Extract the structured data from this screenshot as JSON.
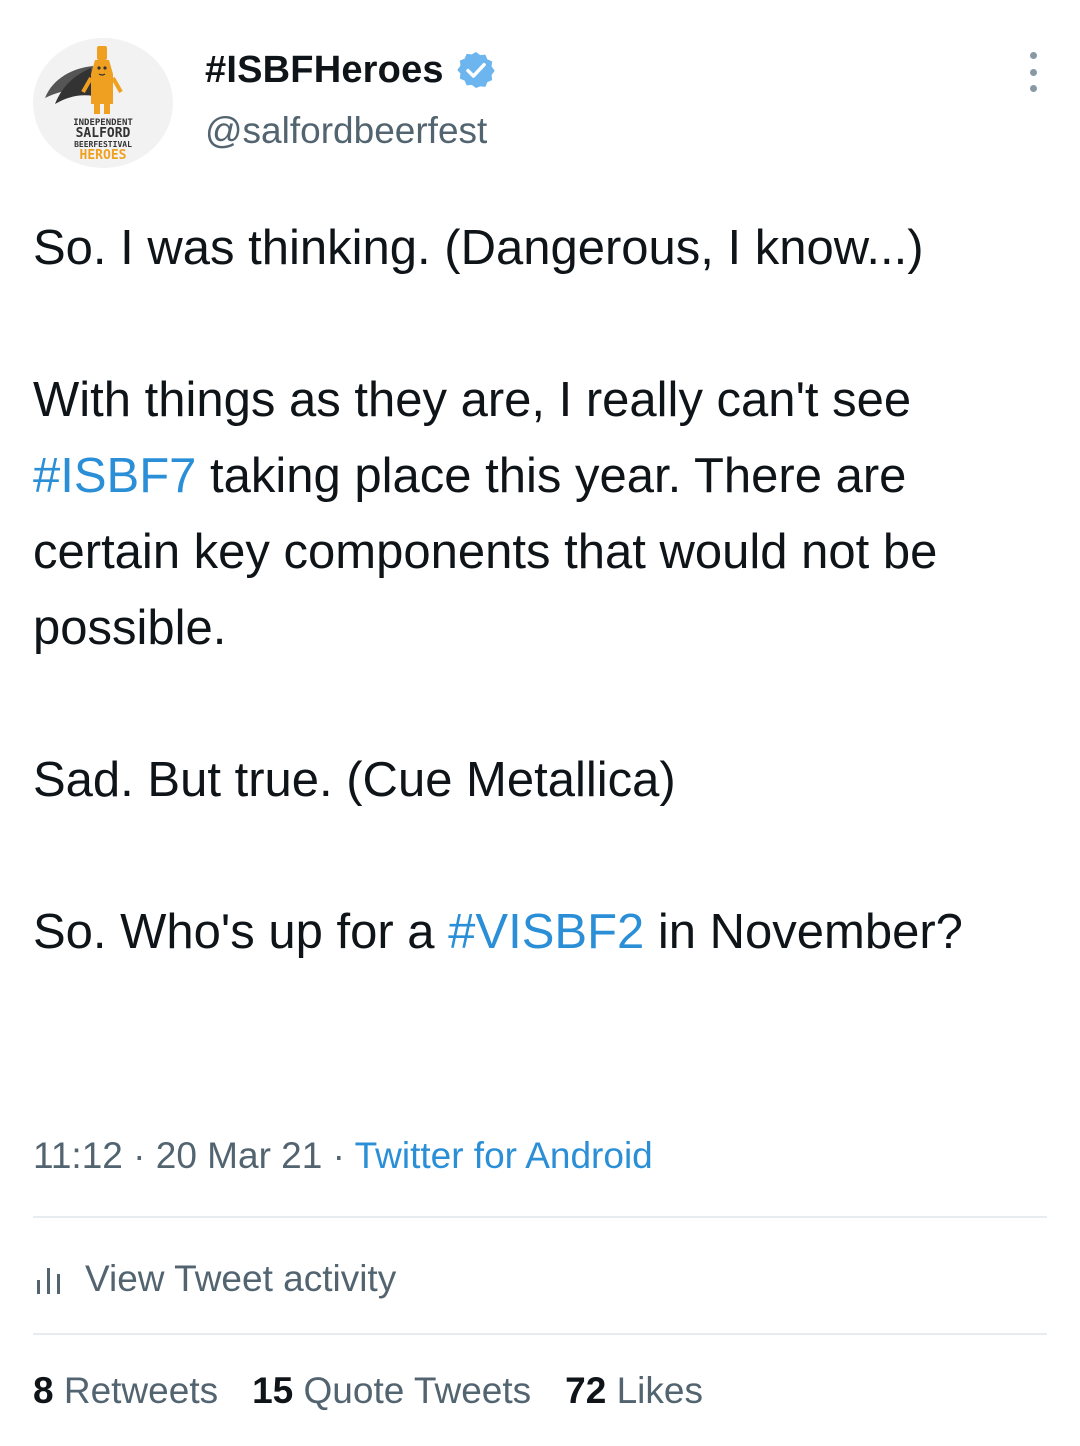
{
  "header": {
    "display_name": "#ISBFHeroes",
    "handle": "@salfordbeerfest",
    "avatar_logo_text": "INDEPENDENT SALFORD BEERFESTIVAL HEROES"
  },
  "tweet": {
    "p1": "So. I was thinking. (Dangerous, I know...)",
    "p2_a": "With things as they are, I really can't see ",
    "p2_hashtag": "#ISBF7",
    "p2_b": " taking place this year. There are certain key components that would not be possible.",
    "p3": "Sad. But true. (Cue Metallica)",
    "p4_a": "So. Who's up for a ",
    "p4_hashtag": "#VISBF2",
    "p4_b": " in November?"
  },
  "meta": {
    "time": "11:12",
    "sep1": " · ",
    "date": "20 Mar 21",
    "sep2": " · ",
    "source": "Twitter for Android"
  },
  "activity": {
    "label": "View Tweet activity"
  },
  "stats": {
    "retweets_count": "8",
    "retweets_label": "Retweets",
    "quotes_count": "15",
    "quotes_label": "Quote Tweets",
    "likes_count": "72",
    "likes_label": "Likes"
  },
  "colors": {
    "link": "#2a8fd6",
    "verified": "#6cb5ef",
    "secondary_text": "#536471",
    "divider": "#e6ecf0",
    "logo_orange": "#f0a020"
  },
  "icons": {
    "verified": "verified-badge-icon",
    "more": "more-vertical-icon",
    "activity": "bar-chart-icon"
  }
}
